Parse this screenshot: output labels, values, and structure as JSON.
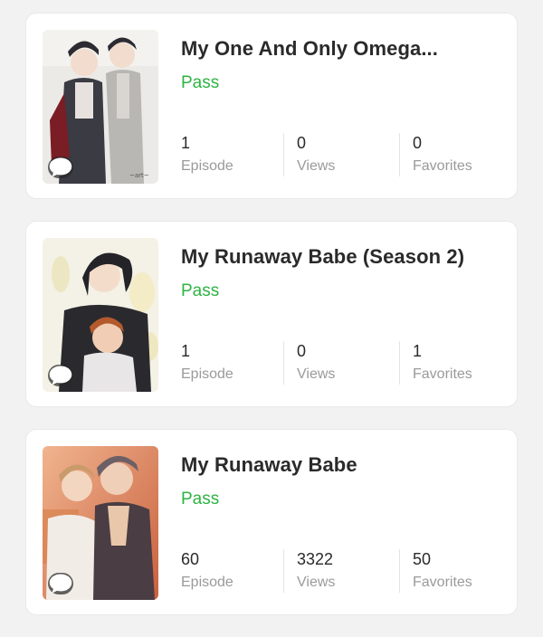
{
  "series_list": [
    {
      "title": "My One And Only Omega...",
      "status": "Pass",
      "stats": [
        {
          "value": "1",
          "label": "Episode"
        },
        {
          "value": "0",
          "label": "Views"
        },
        {
          "value": "0",
          "label": "Favorites"
        }
      ],
      "cover_colors": {
        "bg": "#eceae7",
        "accent": "#3b3b44"
      }
    },
    {
      "title": "My Runaway Babe (Season 2)",
      "status": "Pass",
      "stats": [
        {
          "value": "1",
          "label": "Episode"
        },
        {
          "value": "0",
          "label": "Views"
        },
        {
          "value": "1",
          "label": "Favorites"
        }
      ],
      "cover_colors": {
        "bg": "#f4f1e6",
        "accent": "#242428"
      }
    },
    {
      "title": "My Runaway Babe",
      "status": "Pass",
      "stats": [
        {
          "value": "60",
          "label": "Episode"
        },
        {
          "value": "3322",
          "label": "Views"
        },
        {
          "value": "50",
          "label": "Favorites"
        }
      ],
      "cover_colors": {
        "bg": "#e9a480",
        "accent": "#5a4a52"
      }
    }
  ],
  "colors": {
    "status_green": "#2fb344",
    "label_gray": "#9a9a9a",
    "title_dark": "#2a2a2a"
  },
  "icons": {
    "comment": "comment-bubble-icon"
  }
}
